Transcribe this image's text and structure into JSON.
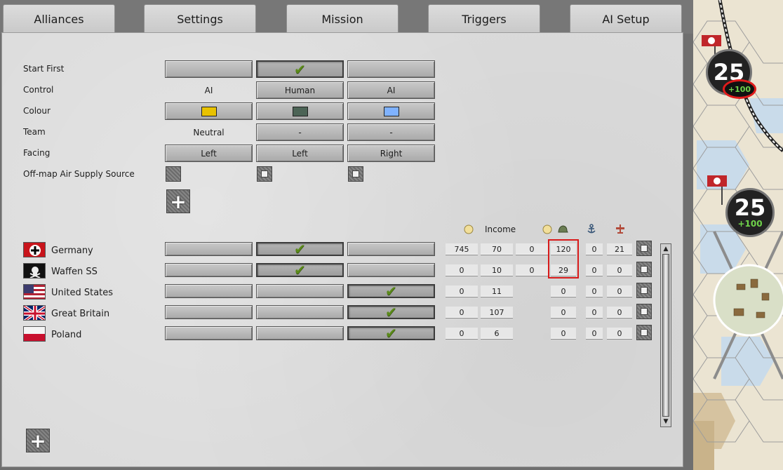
{
  "tabs": [
    "Alliances",
    "Settings",
    "Mission",
    "Triggers",
    "AI Setup"
  ],
  "rows": {
    "start_first": "Start First",
    "control": "Control",
    "colour": "Colour",
    "team": "Team",
    "facing": "Facing",
    "air_supply": "Off-map Air Supply Source"
  },
  "players": [
    {
      "control": "AI",
      "colour": "#e8c200",
      "team": "Neutral",
      "facing": "Left",
      "start_first": false
    },
    {
      "control": "Human",
      "colour": "#4c6456",
      "team": "-",
      "facing": "Left",
      "start_first": true
    },
    {
      "control": "AI",
      "colour": "#7fb2ff",
      "team": "-",
      "facing": "Right",
      "start_first": false
    }
  ],
  "income_header": "Income",
  "nations": [
    {
      "name": "Germany",
      "side": 1,
      "values": [
        "745",
        "70",
        "0",
        "120",
        "0",
        "21"
      ]
    },
    {
      "name": "Waffen SS",
      "side": 1,
      "values": [
        "0",
        "10",
        "0",
        "29",
        "0",
        "0"
      ]
    },
    {
      "name": "United States",
      "side": 2,
      "values": [
        "0",
        "11",
        "",
        "0",
        "0",
        "0"
      ]
    },
    {
      "name": "Great Britain",
      "side": 2,
      "values": [
        "0",
        "107",
        "",
        "0",
        "0",
        "0"
      ]
    },
    {
      "name": "Poland",
      "side": 2,
      "values": [
        "0",
        "6",
        "",
        "0",
        "0",
        "0"
      ]
    }
  ],
  "map": {
    "unit1_strength": "25",
    "unit1_bonus": "+100",
    "unit2_strength": "25",
    "unit2_bonus": "+100"
  },
  "icons": [
    "check-icon",
    "plus-icon",
    "coin-icon",
    "helmet-icon",
    "anchor-icon",
    "plane-icon"
  ]
}
